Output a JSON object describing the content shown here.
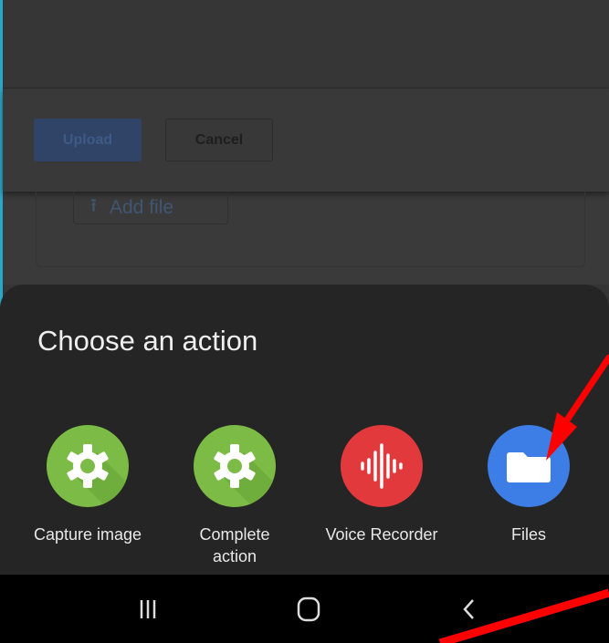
{
  "background": {
    "upload_label": "Upload",
    "cancel_label": "Cancel",
    "add_file_label": "Add file"
  },
  "sheet": {
    "title": "Choose an action",
    "apps": [
      {
        "label": "Capture image",
        "icon": "settings-gear-icon",
        "color": "#7cbb45"
      },
      {
        "label": "Complete\naction",
        "icon": "settings-gear-icon",
        "color": "#7cbb45"
      },
      {
        "label": "Voice Recorder",
        "icon": "sound-wave-icon",
        "color": "#e23a3c"
      },
      {
        "label": "Files",
        "icon": "folder-icon",
        "color": "#3d7de6"
      }
    ]
  },
  "navbar": {
    "buttons": [
      "recent-apps-icon",
      "home-icon",
      "back-icon"
    ]
  },
  "annotation": {
    "arrow_color": "#ff0000"
  }
}
